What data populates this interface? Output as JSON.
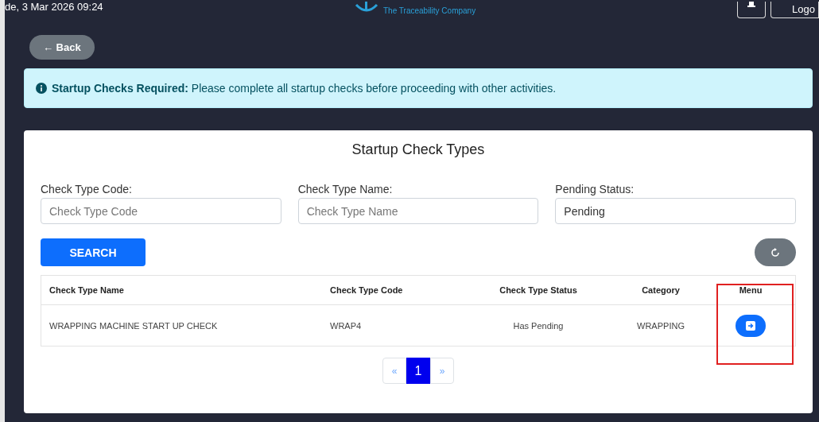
{
  "header": {
    "datetime": "de, 3 Mar 2026 09:24",
    "logo_tagline": "The Traceability Company",
    "logout_label": "Logo"
  },
  "back_button": {
    "label": "← Back"
  },
  "alert": {
    "title": "Startup Checks Required:",
    "message": "Please complete all startup checks before proceeding with other activities."
  },
  "card": {
    "title": "Startup Check Types",
    "filters": [
      {
        "label": "Check Type Code:",
        "placeholder": "Check Type Code"
      },
      {
        "label": "Check Type Name:",
        "placeholder": "Check Type Name"
      },
      {
        "label": "Pending Status:",
        "value": "Pending"
      }
    ],
    "search_button": "SEARCH",
    "table": {
      "columns": [
        "Check Type Name",
        "Check Type Code",
        "Check Type Status",
        "Category",
        "Menu"
      ],
      "rows": [
        {
          "cells": [
            "WRAPPING MACHINE START UP CHECK",
            "WRAP4",
            "Has Pending",
            "WRAPPING"
          ]
        }
      ]
    },
    "pagination": {
      "prev": "«",
      "next": "»",
      "pages": [
        {
          "label": "1",
          "selected": true
        }
      ]
    }
  }
}
